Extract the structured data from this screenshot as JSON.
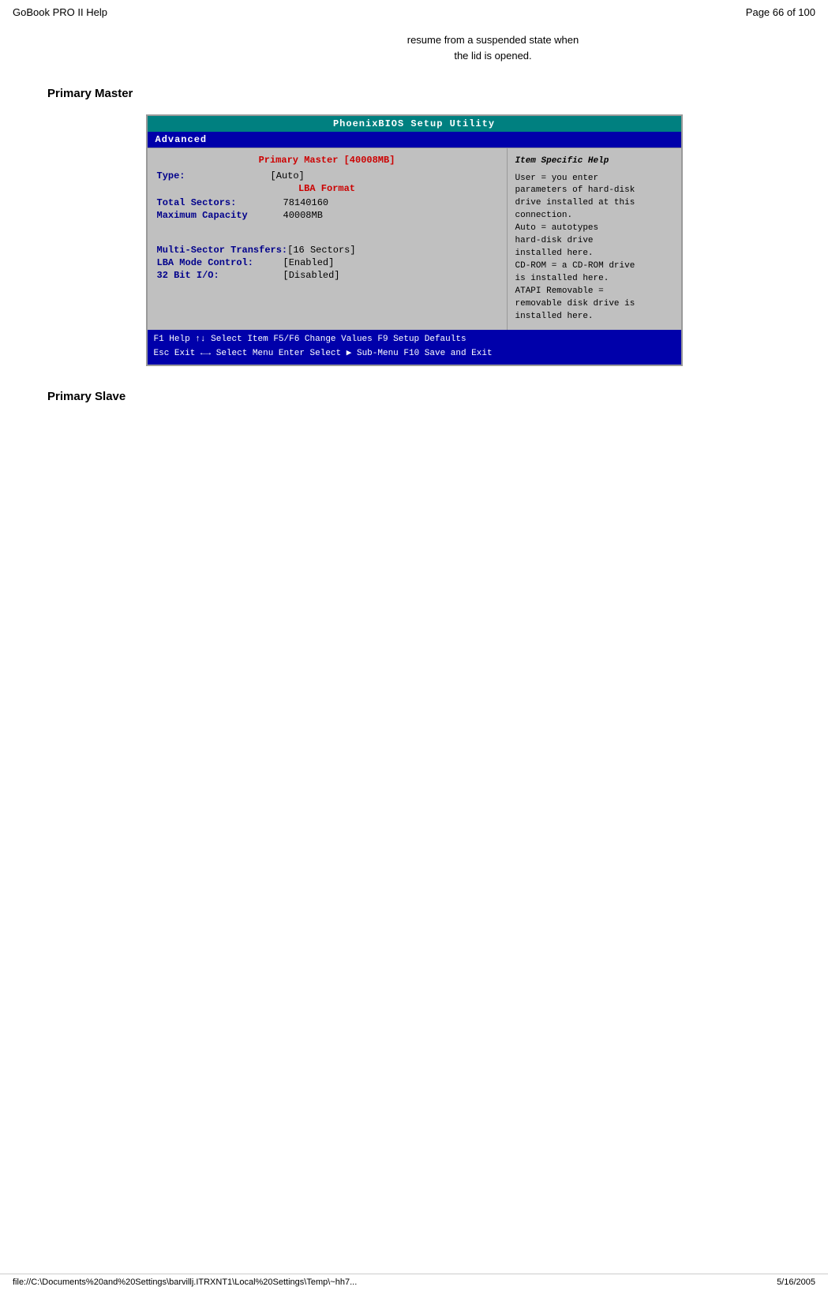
{
  "header": {
    "title": "GoBook PRO II Help",
    "page_info": "Page 66 of 100"
  },
  "intro": {
    "text": "resume from a suspended state when\nthe lid is opened."
  },
  "primary_master": {
    "heading": "Primary Master",
    "bios": {
      "title": "PhoenixBIOS Setup Utility",
      "menu": "Advanced",
      "section_header": "Primary Master   [40008MB]",
      "item_specific_help": "Item Specific Help",
      "type_label": "Type:",
      "type_value": "[Auto]",
      "lba_format": "LBA Format",
      "total_sectors_label": "Total Sectors:",
      "total_sectors_value": "78140160",
      "maximum_capacity_label": "Maximum Capacity",
      "maximum_capacity_value": "40008MB",
      "multi_sector_label": "Multi-Sector Transfers:",
      "multi_sector_value": "[16 Sectors]",
      "lba_mode_label": "LBA Mode Control:",
      "lba_mode_value": "[Enabled]",
      "bit32_label": "32 Bit I/O:",
      "bit32_value": "[Disabled]",
      "help_text": "User = you enter\nparameters of hard-disk\ndrive installed at this\nconnection.\nAuto = autotypes\nhard-disk drive\ninstalled here.\nCD-ROM = a CD-ROM drive\nis installed here.\nATAPI Removable =\nremovable disk drive is\ninstalled here.",
      "footer_line1": "F1  Help  ↑↓ Select Item  F5/F6 Change Values     F9   Setup Defaults",
      "footer_line2": "Esc Exit  ←→ Select Menu  Enter Select ▶ Sub-Menu  F10 Save and Exit"
    }
  },
  "primary_slave": {
    "heading": "Primary Slave"
  },
  "footer": {
    "file_path": "file://C:\\Documents%20and%20Settings\\barvillj.ITRXNT1\\Local%20Settings\\Temp\\~hh7...",
    "date": "5/16/2005"
  }
}
